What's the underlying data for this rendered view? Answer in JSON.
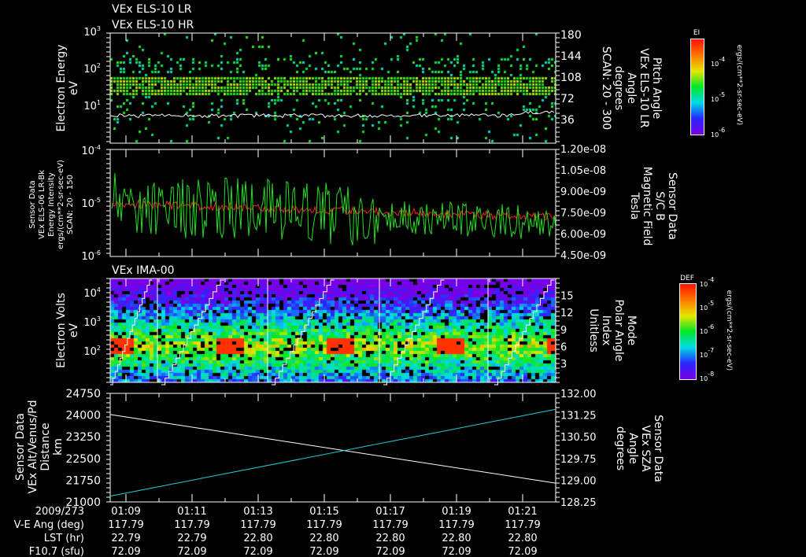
{
  "colors": {
    "background": "#000000",
    "axis": "#ffffff",
    "red": "#ff2020",
    "green": "#20e020",
    "cyan": "#20d0e0"
  },
  "chart_data": [
    {
      "type": "heatmap",
      "titles": [
        "VEx ELS-10 LR",
        "VEx ELS-10 HR"
      ],
      "ylabel": [
        "Electron Energy",
        "eV"
      ],
      "yscale": "log",
      "ylim": [
        1,
        1000
      ],
      "yticks": [
        "10^0",
        "10^1",
        "10^2",
        "10^3"
      ],
      "ytick_labels": [
        {
          "base": "10",
          "exp": "1"
        },
        {
          "base": "10",
          "exp": "2"
        },
        {
          "base": "10",
          "exp": "3"
        }
      ],
      "y2label": [
        "Pitch Angle",
        "VEx ELS-10 LR",
        "Angle",
        "degrees",
        "SCAN: 20 - 300"
      ],
      "y2lim": [
        0,
        180
      ],
      "y2ticks": [
        "36",
        "72",
        "108",
        "144",
        "180"
      ],
      "overlay_line": {
        "name": "pitch angle",
        "color": "#ffffff",
        "approx_value_eV": 6
      },
      "band_eV": [
        20,
        50
      ],
      "colorbar": {
        "title": "EI",
        "labels": [
          "10^-4",
          "10^-5",
          "10^-6"
        ],
        "label_parts": [
          [
            "10",
            "-4"
          ],
          [
            "10",
            "-5"
          ],
          [
            "10",
            "-6"
          ]
        ],
        "units": "ergs/(cm**2-sr-sec-eV)"
      }
    },
    {
      "type": "line",
      "ylabel": [
        "Sensor Data",
        "VEx ELS-06 LR-Bk",
        "Energy Intensity",
        "ergs/(cm**2-sr-sec-eV)",
        "SCAN: 20 - 150"
      ],
      "yscale": "log",
      "ylim": [
        1e-06,
        0.0001
      ],
      "ytick_parts": [
        [
          "10",
          "-4"
        ],
        [
          "10",
          "-5"
        ],
        [
          "10",
          "-6"
        ]
      ],
      "y2label": [
        "Sensor Data",
        "S/C B",
        "Magnetic Field",
        "Tesla"
      ],
      "y2lim": [
        4.5e-09,
        1.2e-08
      ],
      "y2ticks": [
        "1.20e-08",
        "1.05e-08",
        "9.00e-09",
        "7.50e-09",
        "6.00e-09",
        "4.50e-09"
      ],
      "series": [
        {
          "name": "Energy Intensity",
          "color": "#ff2020",
          "axis": "left",
          "start": 1e-05,
          "end": 5.5e-06
        },
        {
          "name": "Magnetic Field",
          "color": "#20e020",
          "axis": "right",
          "start": 8.2e-09,
          "end": 6.8e-09
        }
      ]
    },
    {
      "type": "heatmap",
      "title": "VEx IMA-00",
      "ylabel": [
        "Electron Volts",
        "eV"
      ],
      "yscale": "log",
      "ylim": [
        10,
        31623
      ],
      "ytick_parts": [
        [
          "10",
          "4"
        ],
        [
          "10",
          "3"
        ],
        [
          "10",
          "2"
        ]
      ],
      "y2label": [
        "Mode",
        "Polar Angle",
        "Index",
        "Unitless"
      ],
      "y2lim": [
        0,
        15
      ],
      "y2ticks": [
        "3",
        "6",
        "9",
        "12",
        "15"
      ],
      "peak_eV": 300,
      "colorbar": {
        "title": "DEF",
        "label_parts": [
          [
            "10",
            "-4"
          ],
          [
            "10",
            "-5"
          ],
          [
            "10",
            "-6"
          ],
          [
            "10",
            "-7"
          ],
          [
            "10",
            "-8"
          ]
        ],
        "units": "ergs/(cm**2-sr-sec-eV)"
      }
    },
    {
      "type": "line",
      "ylabel": [
        "Sensor Data",
        "VEx Alt/Venus/Pd",
        "Distance",
        "km"
      ],
      "ylim": [
        21000,
        24750
      ],
      "yticks": [
        "24750",
        "24000",
        "23250",
        "22500",
        "21750",
        "21000"
      ],
      "y2label": [
        "Sensor Data",
        "VEx SZA",
        "Angle",
        "degrees"
      ],
      "y2lim": [
        128.25,
        132.0
      ],
      "y2ticks": [
        "132.00",
        "131.25",
        "130.50",
        "129.75",
        "129.00",
        "128.25"
      ],
      "series": [
        {
          "name": "Altitude",
          "color": "#ffffff",
          "axis": "left",
          "start": 24020,
          "end": 21650
        },
        {
          "name": "SZA",
          "color": "#20d0e0",
          "axis": "right",
          "start": 128.45,
          "end": 131.45
        }
      ]
    }
  ],
  "xaxis": {
    "date": "2009/273",
    "ticks": [
      "01:09",
      "01:11",
      "01:13",
      "01:15",
      "01:17",
      "01:19",
      "01:21"
    ],
    "rows": [
      {
        "label": "V-E Ang (deg)",
        "values": [
          "117.79",
          "117.79",
          "117.79",
          "117.79",
          "117.79",
          "117.79",
          "117.79"
        ]
      },
      {
        "label": "LST (hr)",
        "values": [
          "22.79",
          "22.79",
          "22.80",
          "22.80",
          "22.80",
          "22.80",
          "22.80"
        ]
      },
      {
        "label": "F10.7 (sfu)",
        "values": [
          "72.09",
          "72.09",
          "72.09",
          "72.09",
          "72.09",
          "72.09",
          "72.09"
        ]
      }
    ]
  }
}
